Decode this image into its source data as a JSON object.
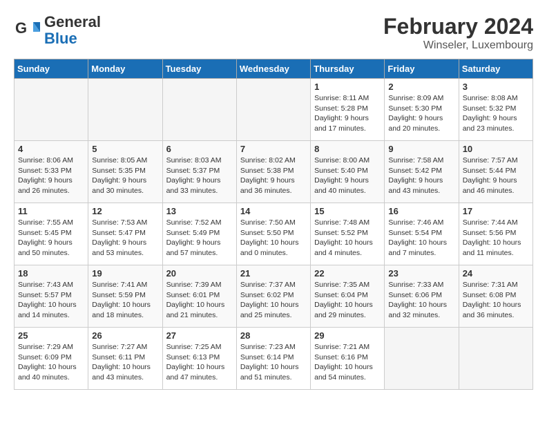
{
  "header": {
    "logo_line1": "General",
    "logo_line2": "Blue",
    "month_title": "February 2024",
    "location": "Winseler, Luxembourg"
  },
  "weekdays": [
    "Sunday",
    "Monday",
    "Tuesday",
    "Wednesday",
    "Thursday",
    "Friday",
    "Saturday"
  ],
  "weeks": [
    [
      {
        "day": "",
        "empty": true
      },
      {
        "day": "",
        "empty": true
      },
      {
        "day": "",
        "empty": true
      },
      {
        "day": "",
        "empty": true
      },
      {
        "day": "1",
        "sunrise": "8:11 AM",
        "sunset": "5:28 PM",
        "daylight": "9 hours and 17 minutes."
      },
      {
        "day": "2",
        "sunrise": "8:09 AM",
        "sunset": "5:30 PM",
        "daylight": "9 hours and 20 minutes."
      },
      {
        "day": "3",
        "sunrise": "8:08 AM",
        "sunset": "5:32 PM",
        "daylight": "9 hours and 23 minutes."
      }
    ],
    [
      {
        "day": "4",
        "sunrise": "8:06 AM",
        "sunset": "5:33 PM",
        "daylight": "9 hours and 26 minutes."
      },
      {
        "day": "5",
        "sunrise": "8:05 AM",
        "sunset": "5:35 PM",
        "daylight": "9 hours and 30 minutes."
      },
      {
        "day": "6",
        "sunrise": "8:03 AM",
        "sunset": "5:37 PM",
        "daylight": "9 hours and 33 minutes."
      },
      {
        "day": "7",
        "sunrise": "8:02 AM",
        "sunset": "5:38 PM",
        "daylight": "9 hours and 36 minutes."
      },
      {
        "day": "8",
        "sunrise": "8:00 AM",
        "sunset": "5:40 PM",
        "daylight": "9 hours and 40 minutes."
      },
      {
        "day": "9",
        "sunrise": "7:58 AM",
        "sunset": "5:42 PM",
        "daylight": "9 hours and 43 minutes."
      },
      {
        "day": "10",
        "sunrise": "7:57 AM",
        "sunset": "5:44 PM",
        "daylight": "9 hours and 46 minutes."
      }
    ],
    [
      {
        "day": "11",
        "sunrise": "7:55 AM",
        "sunset": "5:45 PM",
        "daylight": "9 hours and 50 minutes."
      },
      {
        "day": "12",
        "sunrise": "7:53 AM",
        "sunset": "5:47 PM",
        "daylight": "9 hours and 53 minutes."
      },
      {
        "day": "13",
        "sunrise": "7:52 AM",
        "sunset": "5:49 PM",
        "daylight": "9 hours and 57 minutes."
      },
      {
        "day": "14",
        "sunrise": "7:50 AM",
        "sunset": "5:50 PM",
        "daylight": "10 hours and 0 minutes."
      },
      {
        "day": "15",
        "sunrise": "7:48 AM",
        "sunset": "5:52 PM",
        "daylight": "10 hours and 4 minutes."
      },
      {
        "day": "16",
        "sunrise": "7:46 AM",
        "sunset": "5:54 PM",
        "daylight": "10 hours and 7 minutes."
      },
      {
        "day": "17",
        "sunrise": "7:44 AM",
        "sunset": "5:56 PM",
        "daylight": "10 hours and 11 minutes."
      }
    ],
    [
      {
        "day": "18",
        "sunrise": "7:43 AM",
        "sunset": "5:57 PM",
        "daylight": "10 hours and 14 minutes."
      },
      {
        "day": "19",
        "sunrise": "7:41 AM",
        "sunset": "5:59 PM",
        "daylight": "10 hours and 18 minutes."
      },
      {
        "day": "20",
        "sunrise": "7:39 AM",
        "sunset": "6:01 PM",
        "daylight": "10 hours and 21 minutes."
      },
      {
        "day": "21",
        "sunrise": "7:37 AM",
        "sunset": "6:02 PM",
        "daylight": "10 hours and 25 minutes."
      },
      {
        "day": "22",
        "sunrise": "7:35 AM",
        "sunset": "6:04 PM",
        "daylight": "10 hours and 29 minutes."
      },
      {
        "day": "23",
        "sunrise": "7:33 AM",
        "sunset": "6:06 PM",
        "daylight": "10 hours and 32 minutes."
      },
      {
        "day": "24",
        "sunrise": "7:31 AM",
        "sunset": "6:08 PM",
        "daylight": "10 hours and 36 minutes."
      }
    ],
    [
      {
        "day": "25",
        "sunrise": "7:29 AM",
        "sunset": "6:09 PM",
        "daylight": "10 hours and 40 minutes."
      },
      {
        "day": "26",
        "sunrise": "7:27 AM",
        "sunset": "6:11 PM",
        "daylight": "10 hours and 43 minutes."
      },
      {
        "day": "27",
        "sunrise": "7:25 AM",
        "sunset": "6:13 PM",
        "daylight": "10 hours and 47 minutes."
      },
      {
        "day": "28",
        "sunrise": "7:23 AM",
        "sunset": "6:14 PM",
        "daylight": "10 hours and 51 minutes."
      },
      {
        "day": "29",
        "sunrise": "7:21 AM",
        "sunset": "6:16 PM",
        "daylight": "10 hours and 54 minutes."
      },
      {
        "day": "",
        "empty": true
      },
      {
        "day": "",
        "empty": true
      }
    ]
  ]
}
